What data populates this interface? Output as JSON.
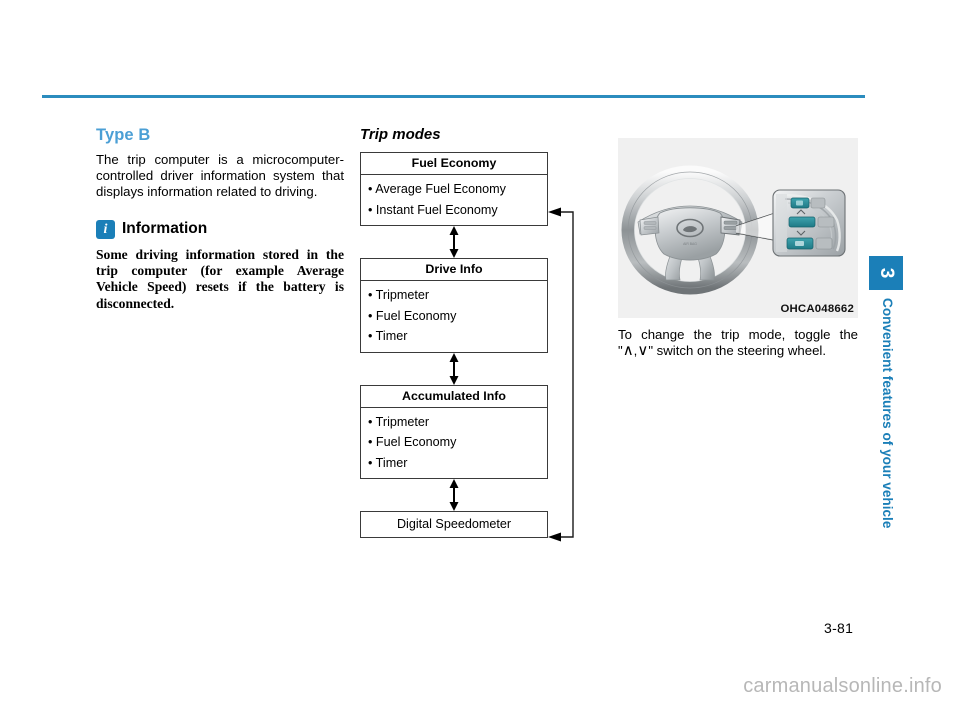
{
  "page": {
    "number": "3-81",
    "watermark": "carmanualsonline.info",
    "accent_color": "#2b8cbe",
    "heading_color": "#4b9fd5",
    "tab_color": "#1b7fb8"
  },
  "chapter_tab": {
    "number": "3",
    "label": "Convenient features of your vehicle"
  },
  "left_column": {
    "heading": "Type B",
    "intro": "The trip computer is a microcomputer-controlled driver information system that displays information related to driving.",
    "information": {
      "icon": "info-icon",
      "title": "Information",
      "body": "Some driving information stored in the trip computer (for example Average Vehicle Speed) resets if the battery is disconnected."
    }
  },
  "flowchart": {
    "heading": "Trip modes",
    "boxes": [
      {
        "title": "Fuel Economy",
        "items": [
          "• Average Fuel Economy",
          "• Instant Fuel Economy"
        ]
      },
      {
        "title": "Drive Info",
        "items": [
          "• Tripmeter",
          "• Fuel Economy",
          "• Timer"
        ]
      },
      {
        "title": "Accumulated Info",
        "items": [
          "• Tripmeter",
          "• Fuel Economy",
          "• Timer"
        ]
      },
      {
        "title": "Digital Speedometer",
        "items": []
      }
    ]
  },
  "right_column": {
    "illustration": {
      "name": "steering-wheel-controls-illustration",
      "code": "OHCA048662"
    },
    "caption_line1": "To change the trip mode, toggle the",
    "caption_quote_open": "\"",
    "caption_chevron_up": "∧",
    "caption_comma": ",",
    "caption_chevron_down": "∨",
    "caption_quote_close": "\"",
    "caption_line2": " switch on the steering wheel."
  }
}
